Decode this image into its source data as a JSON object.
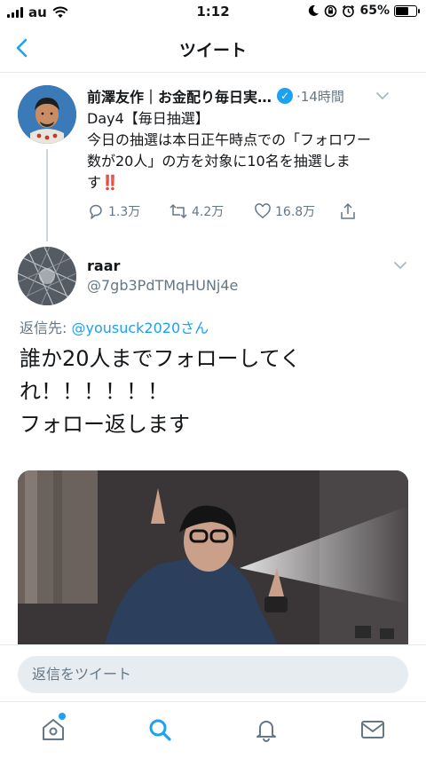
{
  "status_bar": {
    "carrier": "au",
    "time": "1:12",
    "battery": "65%",
    "battery_level": 0.65,
    "icons": [
      "signal-icon",
      "wifi-icon",
      "moon-icon",
      "rotation-lock-icon",
      "alarm-icon",
      "battery-icon"
    ]
  },
  "nav": {
    "title": "ツイート",
    "back_icon": "chevron-left-icon"
  },
  "tweet1": {
    "name": "前澤友作｜お金配り毎日実…",
    "time": "·14時間",
    "lines": [
      "Day4【毎日抽選】",
      "今日の抽選は本日正午時点での「フォロワー",
      "数が20人」の方を対象に10名を抽選しま",
      "す"
    ],
    "emphasis": "‼️",
    "replies": "1.3万",
    "retweets": "4.2万",
    "likes": "16.8万"
  },
  "tweet2": {
    "name": "raar",
    "handle": "@7gb3PdTMqHUNj4e",
    "reply_prefix": "返信先: ",
    "reply_mention": "@yousuck2020さん",
    "lines": [
      "誰か20人までフォローしてく",
      "れ！！！！！！",
      "フォロー返します"
    ]
  },
  "reply_bar": {
    "placeholder": "返信をツイート"
  },
  "tabs": [
    "home-icon",
    "search-icon",
    "notifications-icon",
    "messages-icon"
  ],
  "colors": {
    "accent": "#1da1f2",
    "muted": "#657786",
    "text": "#14171a",
    "divider": "#e6ecf0"
  }
}
